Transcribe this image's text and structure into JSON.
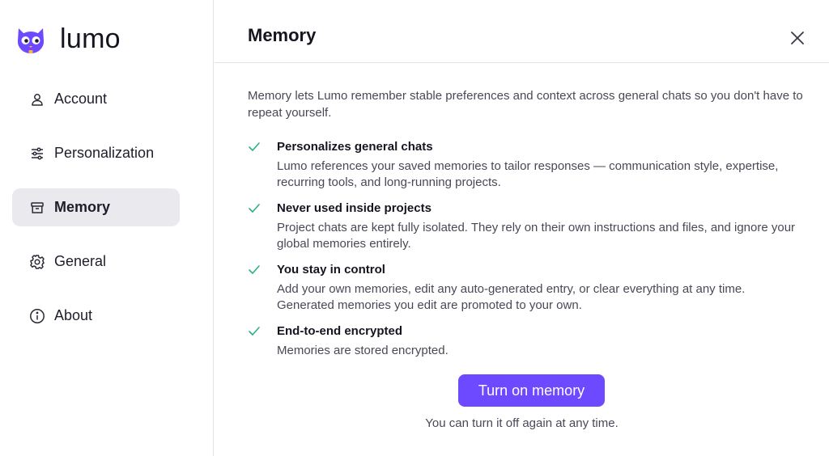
{
  "brand": {
    "name": "lumo"
  },
  "sidebar": {
    "items": [
      {
        "label": "Account",
        "icon": "user-icon",
        "active": false
      },
      {
        "label": "Personalization",
        "icon": "sliders-icon",
        "active": false
      },
      {
        "label": "Memory",
        "icon": "archive-box-icon",
        "active": true
      },
      {
        "label": "General",
        "icon": "gear-icon",
        "active": false
      },
      {
        "label": "About",
        "icon": "info-circle-icon",
        "active": false
      }
    ]
  },
  "panel": {
    "title": "Memory",
    "intro": "Memory lets Lumo remember stable preferences and context across general chats so you don't have to repeat yourself.",
    "features": [
      {
        "title": "Personalizes general chats",
        "description": "Lumo references your saved memories to tailor responses — communication style, expertise, recurring tools, and long-running projects."
      },
      {
        "title": "Never used inside projects",
        "description": "Project chats are kept fully isolated. They rely on their own instructions and files, and ignore your global memories entirely."
      },
      {
        "title": "You stay in control",
        "description": "Add your own memories, edit any auto-generated entry, or clear everything at any time. Generated memories you edit are promoted to your own."
      },
      {
        "title": "End-to-end encrypted",
        "description": "Memories are stored encrypted."
      }
    ],
    "cta_label": "Turn on memory",
    "cta_note": "You can turn it off again at any time."
  },
  "colors": {
    "accent": "#6d4aff",
    "check": "#2fb187",
    "active_bg": "#eaeaee"
  }
}
